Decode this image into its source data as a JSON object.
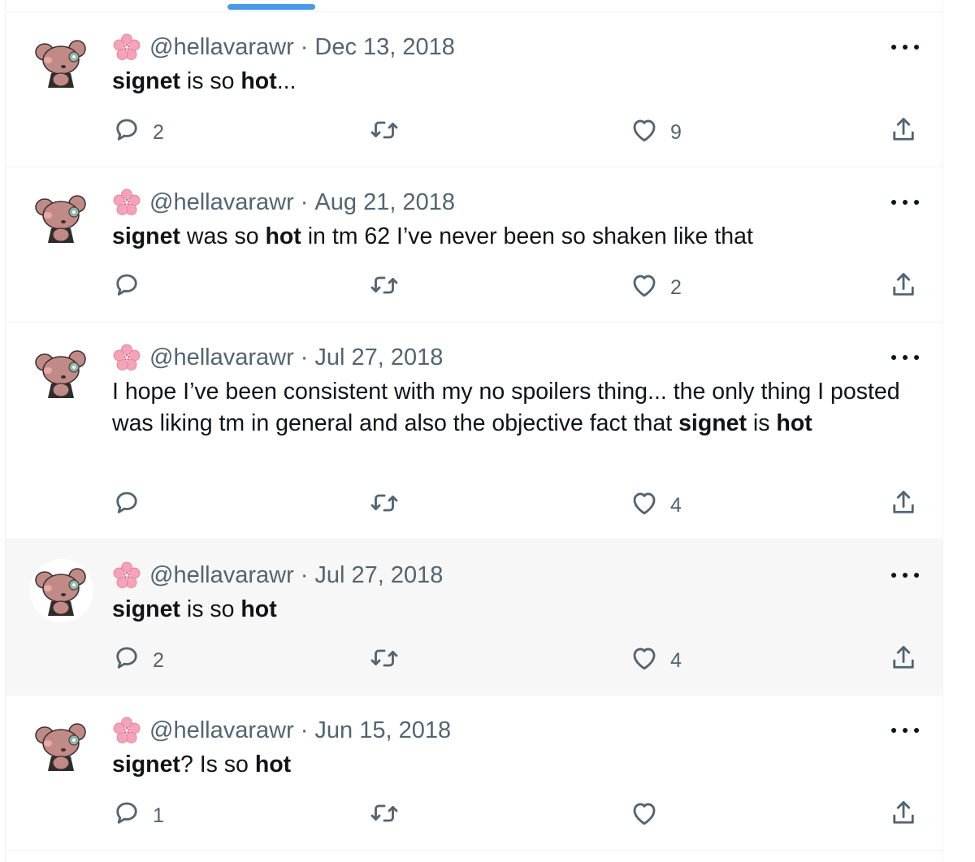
{
  "tweets": [
    {
      "handle": "@hellavarawr",
      "separator": "·",
      "date": "Dec 13, 2018",
      "text": [
        {
          "t": "signet",
          "b": true
        },
        {
          "t": " is so "
        },
        {
          "t": "hot",
          "b": true
        },
        {
          "t": "..."
        }
      ],
      "replies": "2",
      "retweets": "",
      "likes": "9"
    },
    {
      "handle": "@hellavarawr",
      "separator": "·",
      "date": "Aug 21, 2018",
      "text": [
        {
          "t": "signet",
          "b": true
        },
        {
          "t": " was so "
        },
        {
          "t": "hot",
          "b": true
        },
        {
          "t": " in tm 62 I’ve never been so shaken like that"
        }
      ],
      "replies": "",
      "retweets": "",
      "likes": "2"
    },
    {
      "handle": "@hellavarawr",
      "separator": "·",
      "date": "Jul 27, 2018",
      "text": [
        {
          "t": "I hope I’ve been consistent with my no spoilers thing... the only thing I posted was liking tm in general and also the objective fact that "
        },
        {
          "t": "signet",
          "b": true
        },
        {
          "t": " is "
        },
        {
          "t": "hot",
          "b": true
        }
      ],
      "replies": "",
      "retweets": "",
      "likes": "4"
    },
    {
      "handle": "@hellavarawr",
      "separator": "·",
      "date": "Jul 27, 2018",
      "text": [
        {
          "t": "signet",
          "b": true
        },
        {
          "t": " is so "
        },
        {
          "t": "hot",
          "b": true
        }
      ],
      "replies": "2",
      "retweets": "",
      "likes": "4"
    },
    {
      "handle": "@hellavarawr",
      "separator": "·",
      "date": "Jun 15, 2018",
      "text": [
        {
          "t": "signet",
          "b": true
        },
        {
          "t": "? Is so "
        },
        {
          "t": "hot",
          "b": true
        }
      ],
      "replies": "1",
      "retweets": "",
      "likes": ""
    }
  ],
  "colors": {
    "accent": "#4a99e9",
    "text": "#0f1419",
    "muted": "#536471",
    "highlight_bg": "#f7f7f7",
    "avatar_bear": "#c08a86"
  },
  "icons": [
    "cherry-blossom-icon",
    "more-icon",
    "reply-icon",
    "retweet-icon",
    "like-icon",
    "share-icon",
    "bear-avatar"
  ]
}
